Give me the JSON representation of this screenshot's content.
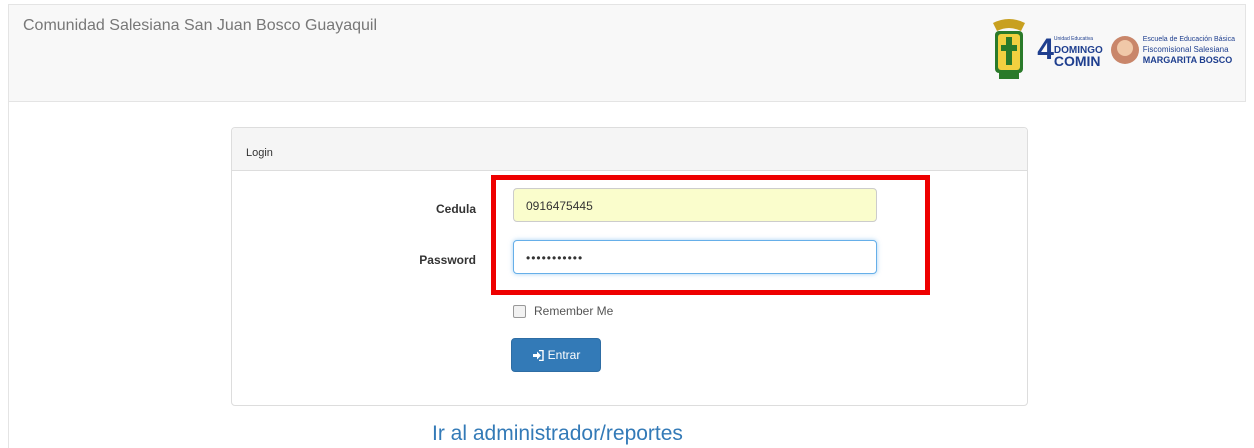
{
  "navbar": {
    "brand": "Comunidad Salesiana San Juan Bosco Guayaquil",
    "logo_domingo": {
      "number": "4",
      "small": "Unidad Educativa",
      "line1": "DOMINGO",
      "line2": "COMIN"
    },
    "logo_margarita": {
      "line1": "Escuela de Educación Básica",
      "line2": "Fiscomisional Salesiana",
      "line3": "MARGARITA BOSCO"
    }
  },
  "panel": {
    "heading": "Login"
  },
  "form": {
    "cedula_label": "Cedula",
    "cedula_value": "0916475445",
    "password_label": "Password",
    "password_value": "•••••••••••",
    "remember_label": "Remember Me",
    "submit_label": "Entrar",
    "submit_icon": "sign-in-icon"
  },
  "footer": {
    "admin_link": "Ir al administrador/reportes"
  },
  "colors": {
    "primary": "#337ab7",
    "highlight": "#ee0000",
    "autofill": "#fafdcc"
  }
}
